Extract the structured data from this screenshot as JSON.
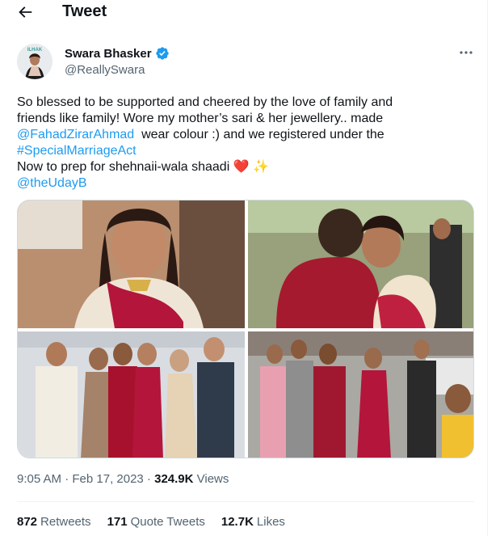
{
  "header": {
    "title": "Tweet"
  },
  "author": {
    "name": "Swara Bhasker",
    "handle": "@ReallySwara",
    "avatar_badge_text": "ILHAK"
  },
  "tweet": {
    "line1": "So blessed to be supported and cheered by the love of family and",
    "line2": "friends like family! Wore my mother’s sari & her jewellery.. made",
    "mention1": "@FahadZirarAhmad",
    "line3_rest": "  wear colour :) and we registered under the",
    "hashtag": "#SpecialMarriageAct",
    "line5": "Now to prep for shehnaii-wala shaadi",
    "emoji": "❤️ ✨",
    "mention2": "@theUdayB"
  },
  "meta": {
    "time": "9:05 AM · Feb 17, 2023 · ",
    "views_count": "324.9K",
    "views_label": " Views"
  },
  "stats": [
    {
      "count": "872",
      "label": "Retweets"
    },
    {
      "count": "171",
      "label": "Quote Tweets"
    },
    {
      "count": "12.7K",
      "label": "Likes"
    }
  ],
  "colors": {
    "link": "#1d9bf0",
    "verified": "#1d9bf0",
    "secondary_text": "#536471",
    "border": "#cfd9de"
  }
}
